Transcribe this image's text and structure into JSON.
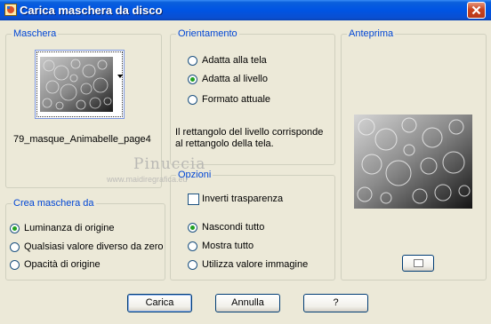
{
  "window": {
    "title": "Carica maschera da disco"
  },
  "maschera": {
    "legend": "Maschera",
    "file_name": "79_masque_Animabelle_page4"
  },
  "orientamento": {
    "legend": "Orientamento",
    "options": [
      "Adatta alla tela",
      "Adatta al livello",
      "Formato attuale"
    ],
    "selected": "Adatta al livello",
    "description": "Il rettangolo del livello corrisponde al rettangolo della tela."
  },
  "anteprima": {
    "legend": "Anteprima"
  },
  "opzioni": {
    "legend": "Opzioni",
    "inverti_label": "Inverti trasparenza",
    "inverti_checked": false,
    "options": [
      "Nascondi tutto",
      "Mostra tutto",
      "Utilizza valore immagine"
    ],
    "selected": "Nascondi tutto"
  },
  "crea": {
    "legend": "Crea maschera da",
    "options": [
      "Luminanza di origine",
      "Qualsiasi valore diverso da zero",
      "Opacità di origine"
    ],
    "selected": "Luminanza di origine"
  },
  "watermark": {
    "name": "Pinuccia",
    "site": "www.maidiregrafica.eu"
  },
  "buttons": {
    "carica": "Carica",
    "annulla": "Annulla",
    "help": "?"
  },
  "colors": {
    "titlebar": "#0054e3",
    "legend_text": "#0046d5",
    "radio_selected": "#21a121",
    "face": "#ece9d8"
  }
}
